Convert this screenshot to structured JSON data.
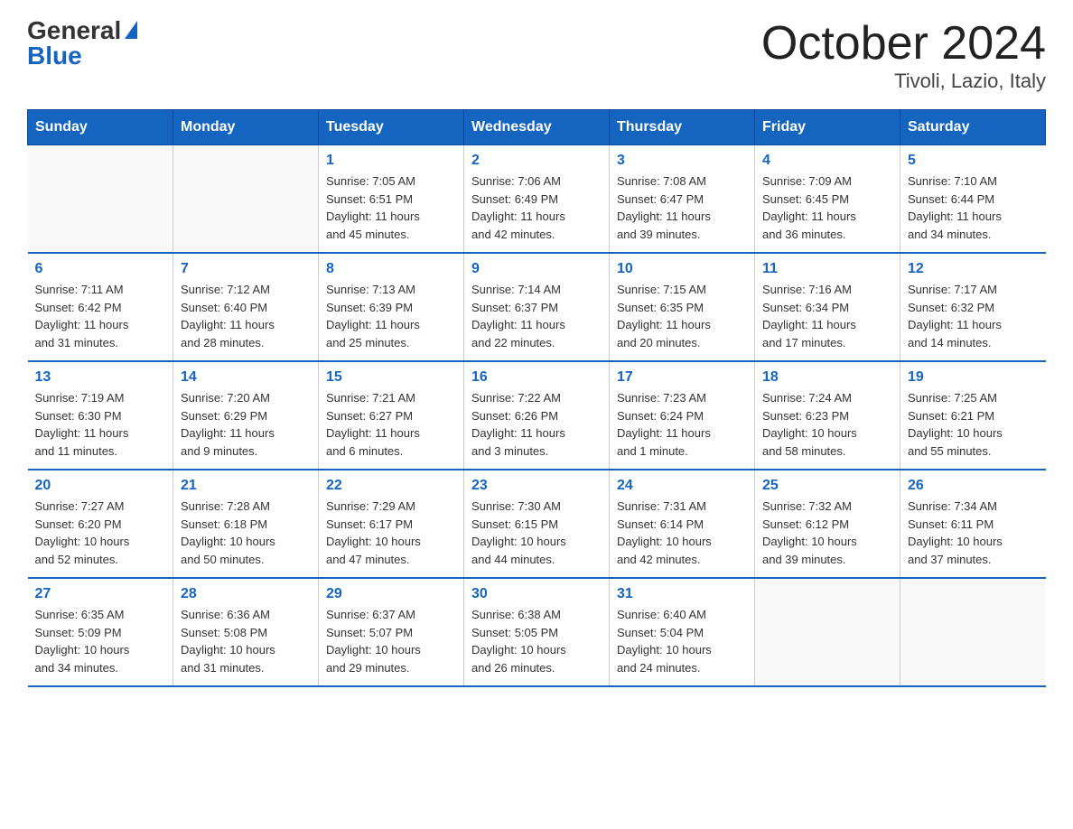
{
  "logo": {
    "general": "General",
    "blue": "Blue"
  },
  "title": "October 2024",
  "location": "Tivoli, Lazio, Italy",
  "days_of_week": [
    "Sunday",
    "Monday",
    "Tuesday",
    "Wednesday",
    "Thursday",
    "Friday",
    "Saturday"
  ],
  "weeks": [
    [
      {
        "day": "",
        "info": ""
      },
      {
        "day": "",
        "info": ""
      },
      {
        "day": "1",
        "info": "Sunrise: 7:05 AM\nSunset: 6:51 PM\nDaylight: 11 hours\nand 45 minutes."
      },
      {
        "day": "2",
        "info": "Sunrise: 7:06 AM\nSunset: 6:49 PM\nDaylight: 11 hours\nand 42 minutes."
      },
      {
        "day": "3",
        "info": "Sunrise: 7:08 AM\nSunset: 6:47 PM\nDaylight: 11 hours\nand 39 minutes."
      },
      {
        "day": "4",
        "info": "Sunrise: 7:09 AM\nSunset: 6:45 PM\nDaylight: 11 hours\nand 36 minutes."
      },
      {
        "day": "5",
        "info": "Sunrise: 7:10 AM\nSunset: 6:44 PM\nDaylight: 11 hours\nand 34 minutes."
      }
    ],
    [
      {
        "day": "6",
        "info": "Sunrise: 7:11 AM\nSunset: 6:42 PM\nDaylight: 11 hours\nand 31 minutes."
      },
      {
        "day": "7",
        "info": "Sunrise: 7:12 AM\nSunset: 6:40 PM\nDaylight: 11 hours\nand 28 minutes."
      },
      {
        "day": "8",
        "info": "Sunrise: 7:13 AM\nSunset: 6:39 PM\nDaylight: 11 hours\nand 25 minutes."
      },
      {
        "day": "9",
        "info": "Sunrise: 7:14 AM\nSunset: 6:37 PM\nDaylight: 11 hours\nand 22 minutes."
      },
      {
        "day": "10",
        "info": "Sunrise: 7:15 AM\nSunset: 6:35 PM\nDaylight: 11 hours\nand 20 minutes."
      },
      {
        "day": "11",
        "info": "Sunrise: 7:16 AM\nSunset: 6:34 PM\nDaylight: 11 hours\nand 17 minutes."
      },
      {
        "day": "12",
        "info": "Sunrise: 7:17 AM\nSunset: 6:32 PM\nDaylight: 11 hours\nand 14 minutes."
      }
    ],
    [
      {
        "day": "13",
        "info": "Sunrise: 7:19 AM\nSunset: 6:30 PM\nDaylight: 11 hours\nand 11 minutes."
      },
      {
        "day": "14",
        "info": "Sunrise: 7:20 AM\nSunset: 6:29 PM\nDaylight: 11 hours\nand 9 minutes."
      },
      {
        "day": "15",
        "info": "Sunrise: 7:21 AM\nSunset: 6:27 PM\nDaylight: 11 hours\nand 6 minutes."
      },
      {
        "day": "16",
        "info": "Sunrise: 7:22 AM\nSunset: 6:26 PM\nDaylight: 11 hours\nand 3 minutes."
      },
      {
        "day": "17",
        "info": "Sunrise: 7:23 AM\nSunset: 6:24 PM\nDaylight: 11 hours\nand 1 minute."
      },
      {
        "day": "18",
        "info": "Sunrise: 7:24 AM\nSunset: 6:23 PM\nDaylight: 10 hours\nand 58 minutes."
      },
      {
        "day": "19",
        "info": "Sunrise: 7:25 AM\nSunset: 6:21 PM\nDaylight: 10 hours\nand 55 minutes."
      }
    ],
    [
      {
        "day": "20",
        "info": "Sunrise: 7:27 AM\nSunset: 6:20 PM\nDaylight: 10 hours\nand 52 minutes."
      },
      {
        "day": "21",
        "info": "Sunrise: 7:28 AM\nSunset: 6:18 PM\nDaylight: 10 hours\nand 50 minutes."
      },
      {
        "day": "22",
        "info": "Sunrise: 7:29 AM\nSunset: 6:17 PM\nDaylight: 10 hours\nand 47 minutes."
      },
      {
        "day": "23",
        "info": "Sunrise: 7:30 AM\nSunset: 6:15 PM\nDaylight: 10 hours\nand 44 minutes."
      },
      {
        "day": "24",
        "info": "Sunrise: 7:31 AM\nSunset: 6:14 PM\nDaylight: 10 hours\nand 42 minutes."
      },
      {
        "day": "25",
        "info": "Sunrise: 7:32 AM\nSunset: 6:12 PM\nDaylight: 10 hours\nand 39 minutes."
      },
      {
        "day": "26",
        "info": "Sunrise: 7:34 AM\nSunset: 6:11 PM\nDaylight: 10 hours\nand 37 minutes."
      }
    ],
    [
      {
        "day": "27",
        "info": "Sunrise: 6:35 AM\nSunset: 5:09 PM\nDaylight: 10 hours\nand 34 minutes."
      },
      {
        "day": "28",
        "info": "Sunrise: 6:36 AM\nSunset: 5:08 PM\nDaylight: 10 hours\nand 31 minutes."
      },
      {
        "day": "29",
        "info": "Sunrise: 6:37 AM\nSunset: 5:07 PM\nDaylight: 10 hours\nand 29 minutes."
      },
      {
        "day": "30",
        "info": "Sunrise: 6:38 AM\nSunset: 5:05 PM\nDaylight: 10 hours\nand 26 minutes."
      },
      {
        "day": "31",
        "info": "Sunrise: 6:40 AM\nSunset: 5:04 PM\nDaylight: 10 hours\nand 24 minutes."
      },
      {
        "day": "",
        "info": ""
      },
      {
        "day": "",
        "info": ""
      }
    ]
  ]
}
